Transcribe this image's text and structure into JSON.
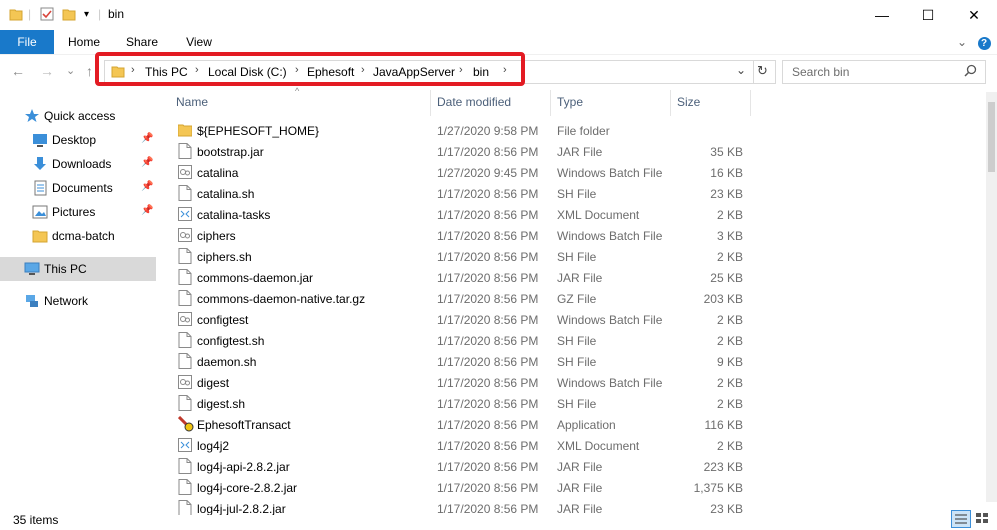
{
  "window": {
    "title": "bin",
    "minimize_glyph": "—",
    "maximize_glyph": "☐",
    "close_glyph": "✕"
  },
  "ribbon": {
    "tabs": [
      "File",
      "Home",
      "Share",
      "View"
    ],
    "help_glyph": "?"
  },
  "nav": {
    "back_glyph": "←",
    "forward_glyph": "→",
    "recent_glyph": "⌄",
    "up_glyph": "↑",
    "breadcrumbs": [
      "This PC",
      "Local Disk (C:)",
      "Ephesoft",
      "JavaAppServer",
      "bin"
    ],
    "crumb_sep": "›",
    "dropdown_glyph": "⌄",
    "refresh_glyph": "↻",
    "search_placeholder": "Search bin"
  },
  "navpane": {
    "items": [
      {
        "label": "Quick access",
        "icon": "star-icon",
        "pinned": false
      },
      {
        "label": "Desktop",
        "icon": "desktop-icon",
        "pinned": true
      },
      {
        "label": "Downloads",
        "icon": "download-icon",
        "pinned": true
      },
      {
        "label": "Documents",
        "icon": "documents-icon",
        "pinned": true
      },
      {
        "label": "Pictures",
        "icon": "pictures-icon",
        "pinned": true
      },
      {
        "label": "dcma-batch",
        "icon": "folder-icon",
        "pinned": false
      },
      {
        "label": "This PC",
        "icon": "pc-icon",
        "pinned": false
      },
      {
        "label": "Network",
        "icon": "network-icon",
        "pinned": false
      }
    ]
  },
  "columns": {
    "name": "Name",
    "date": "Date modified",
    "type": "Type",
    "size": "Size"
  },
  "files": [
    {
      "name": "${EPHESOFT_HOME}",
      "date": "1/27/2020 9:58 PM",
      "type": "File folder",
      "size": "",
      "icon": "folder"
    },
    {
      "name": "bootstrap.jar",
      "date": "1/17/2020 8:56 PM",
      "type": "JAR File",
      "size": "35 KB",
      "icon": "file"
    },
    {
      "name": "catalina",
      "date": "1/27/2020 9:45 PM",
      "type": "Windows Batch File",
      "size": "16 KB",
      "icon": "batch"
    },
    {
      "name": "catalina.sh",
      "date": "1/17/2020 8:56 PM",
      "type": "SH File",
      "size": "23 KB",
      "icon": "file"
    },
    {
      "name": "catalina-tasks",
      "date": "1/17/2020 8:56 PM",
      "type": "XML Document",
      "size": "2 KB",
      "icon": "xml"
    },
    {
      "name": "ciphers",
      "date": "1/17/2020 8:56 PM",
      "type": "Windows Batch File",
      "size": "3 KB",
      "icon": "batch"
    },
    {
      "name": "ciphers.sh",
      "date": "1/17/2020 8:56 PM",
      "type": "SH File",
      "size": "2 KB",
      "icon": "file"
    },
    {
      "name": "commons-daemon.jar",
      "date": "1/17/2020 8:56 PM",
      "type": "JAR File",
      "size": "25 KB",
      "icon": "file"
    },
    {
      "name": "commons-daemon-native.tar.gz",
      "date": "1/17/2020 8:56 PM",
      "type": "GZ File",
      "size": "203 KB",
      "icon": "file"
    },
    {
      "name": "configtest",
      "date": "1/17/2020 8:56 PM",
      "type": "Windows Batch File",
      "size": "2 KB",
      "icon": "batch"
    },
    {
      "name": "configtest.sh",
      "date": "1/17/2020 8:56 PM",
      "type": "SH File",
      "size": "2 KB",
      "icon": "file"
    },
    {
      "name": "daemon.sh",
      "date": "1/17/2020 8:56 PM",
      "type": "SH File",
      "size": "9 KB",
      "icon": "file"
    },
    {
      "name": "digest",
      "date": "1/17/2020 8:56 PM",
      "type": "Windows Batch File",
      "size": "2 KB",
      "icon": "batch"
    },
    {
      "name": "digest.sh",
      "date": "1/17/2020 8:56 PM",
      "type": "SH File",
      "size": "2 KB",
      "icon": "file"
    },
    {
      "name": "EphesoftTransact",
      "date": "1/17/2020 8:56 PM",
      "type": "Application",
      "size": "116 KB",
      "icon": "app"
    },
    {
      "name": "log4j2",
      "date": "1/17/2020 8:56 PM",
      "type": "XML Document",
      "size": "2 KB",
      "icon": "xml"
    },
    {
      "name": "log4j-api-2.8.2.jar",
      "date": "1/17/2020 8:56 PM",
      "type": "JAR File",
      "size": "223 KB",
      "icon": "file"
    },
    {
      "name": "log4j-core-2.8.2.jar",
      "date": "1/17/2020 8:56 PM",
      "type": "JAR File",
      "size": "1,375 KB",
      "icon": "file"
    },
    {
      "name": "log4j-jul-2.8.2.jar",
      "date": "1/17/2020 8:56 PM",
      "type": "JAR File",
      "size": "23 KB",
      "icon": "file"
    }
  ],
  "status": {
    "item_count": "35 items"
  },
  "colors": {
    "file_tab": "#1979ca",
    "highlight": "#e31b23",
    "selected_nav": "#d9d9d9"
  }
}
